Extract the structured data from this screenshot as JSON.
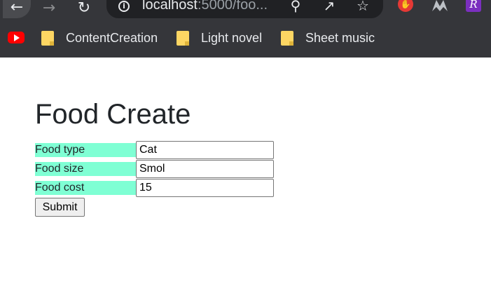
{
  "browser": {
    "url_host": "localhost",
    "url_rest": ":5000/foo...",
    "icons": {
      "back": "back-arrow-icon",
      "forward": "forward-arrow-icon",
      "reload": "reload-icon",
      "site_info": "info-icon",
      "zoom": "zoom-icon",
      "share": "share-icon",
      "bookmark_star": "star-icon"
    }
  },
  "bookmarks": [
    {
      "label": "ContentCreation",
      "icon": "folder-icon"
    },
    {
      "label": "Light novel",
      "icon": "folder-icon"
    },
    {
      "label": "Sheet music",
      "icon": "folder-icon"
    }
  ],
  "page": {
    "title": "Food Create",
    "fields": [
      {
        "label": "Food type",
        "value": "Cat"
      },
      {
        "label": "Food size",
        "value": "Smol"
      },
      {
        "label": "Food cost",
        "value": "15"
      }
    ],
    "submit_label": "Submit"
  },
  "colors": {
    "label_background": "#7fffd4",
    "chrome_background": "#35363a",
    "omnibox_background": "#202124"
  }
}
